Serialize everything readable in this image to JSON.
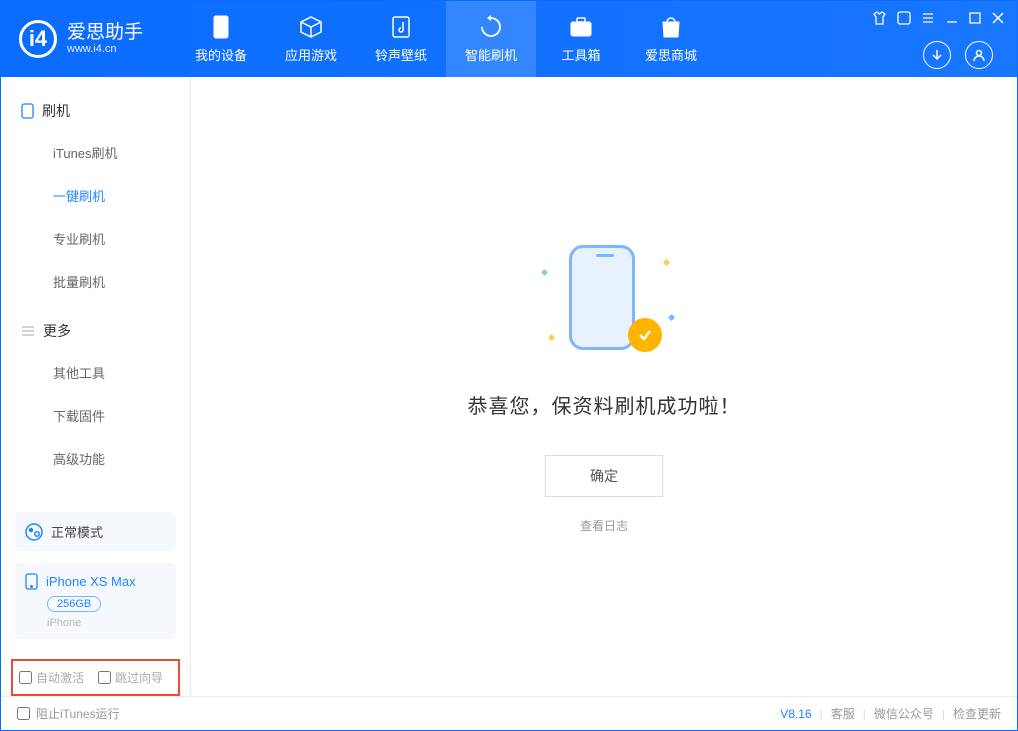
{
  "brand": {
    "name": "爱思助手",
    "url": "www.i4.cn"
  },
  "nav": {
    "device": "我的设备",
    "apps": "应用游戏",
    "ring": "铃声壁纸",
    "flash": "智能刷机",
    "tools": "工具箱",
    "store": "爱思商城"
  },
  "sidebar": {
    "group1": {
      "title": "刷机",
      "items": {
        "itunes": "iTunes刷机",
        "onekey": "一键刷机",
        "pro": "专业刷机",
        "batch": "批量刷机"
      }
    },
    "group2": {
      "title": "更多",
      "items": {
        "other": "其他工具",
        "firmware": "下载固件",
        "advanced": "高级功能"
      }
    }
  },
  "mode": "正常模式",
  "device": {
    "name": "iPhone XS Max",
    "capacity": "256GB",
    "type": "iPhone"
  },
  "options": {
    "auto_activate": "自动激活",
    "skip_guide": "跳过向导"
  },
  "main": {
    "message": "恭喜您，保资料刷机成功啦！",
    "ok": "确定",
    "log": "查看日志"
  },
  "footer": {
    "block_itunes": "阻止iTunes运行",
    "version": "V8.16",
    "service": "客服",
    "wechat": "微信公众号",
    "update": "检查更新"
  }
}
